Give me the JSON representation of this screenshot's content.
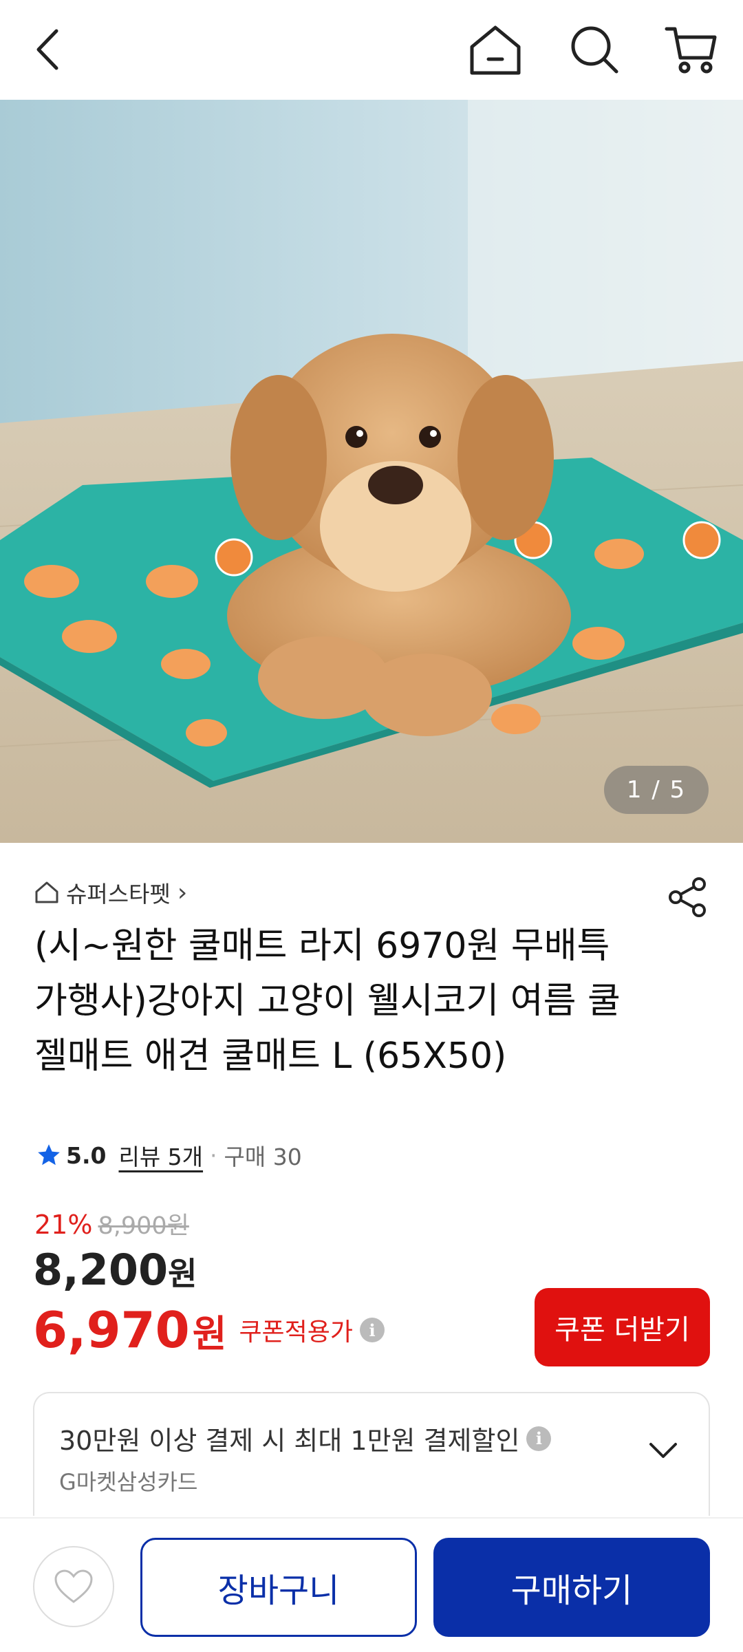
{
  "topbar": {
    "back_icon": "chevron-left-icon",
    "home_icon": "home-icon",
    "search_icon": "search-icon",
    "cart_icon": "cart-icon"
  },
  "gallery": {
    "counter": "1 / 5",
    "image_alt": "product-photo-dog-on-cooling-mat"
  },
  "product": {
    "store_name": "슈퍼스타펫",
    "store_chevron": "›",
    "title": "(시~원한 쿨매트 라지 6970원 무배특가행사)강아지 고양이 웰시코기 여름 쿨젤매트 애견 쿨매트 L (65X50)",
    "rating": "5.0",
    "review": "리뷰 5개",
    "separator": "·",
    "purchases": "구매 30"
  },
  "pricing": {
    "discount_rate": "21%",
    "original_price": "8,900원",
    "sale_price_number": "8,200",
    "sale_price_unit": "원",
    "coupon_price_number": "6,970",
    "coupon_price_unit": "원",
    "coupon_label": "쿠폰적용가",
    "info_glyph": "i",
    "coupon_button": "쿠폰 더받기"
  },
  "card_offer": {
    "main_text": "30만원 이상 결제 시 최대 1만원 결제할인",
    "sub_text": "G마켓삼성카드"
  },
  "actions": {
    "cart_label": "장바구니",
    "buy_label": "구매하기"
  },
  "colors": {
    "accent_red": "#e0110f",
    "brand_blue": "#0a2fa8",
    "mat_teal": "#2cb3a5"
  }
}
